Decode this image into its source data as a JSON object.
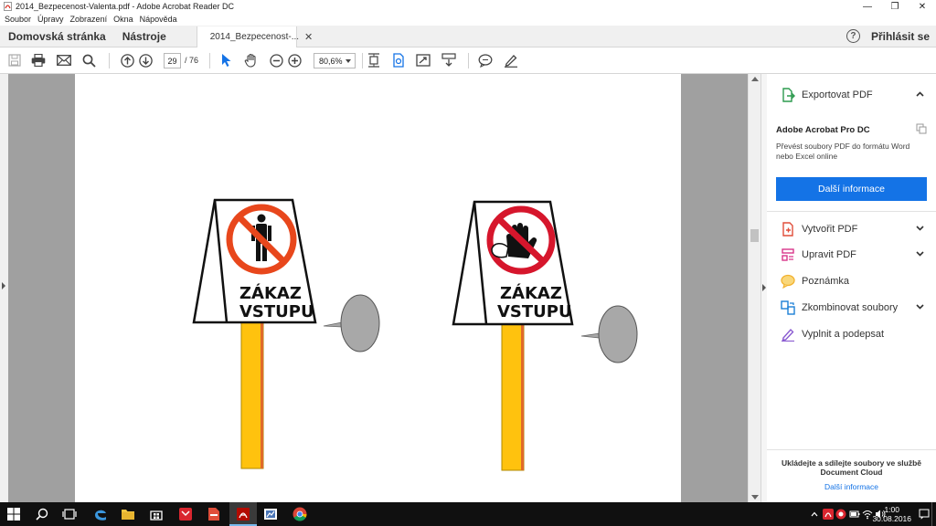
{
  "window": {
    "title": "2014_Bezpecenost-Valenta.pdf - Adobe Acrobat Reader DC",
    "controls": {
      "minimize": "—",
      "restore": "❐",
      "close": "✕"
    }
  },
  "menu": [
    "Soubor",
    "Úpravy",
    "Zobrazení",
    "Okna",
    "Nápověda"
  ],
  "tabs": {
    "home": "Domovská stránka",
    "tools": "Nástroje",
    "document": "2014_Bezpecenost-...",
    "close": "✕",
    "help": "?",
    "signin": "Přihlásit se"
  },
  "toolbar": {
    "page_current": "29",
    "page_total": "/ 76",
    "zoom": "80,6%"
  },
  "page_content": {
    "signs": [
      {
        "line1": "ZÁKAZ",
        "line2": "VSTUPU"
      },
      {
        "line1": "ZÁKAZ",
        "line2": "VSTUPU"
      }
    ]
  },
  "right_panel": {
    "export": {
      "label": "Exportovat PDF",
      "color": "#2d9b4f"
    },
    "promo": {
      "title": "Adobe Acrobat Pro DC",
      "text": "Převést soubory PDF do formátu Word nebo Excel online",
      "button": "Další informace",
      "button_color": "#1473e6"
    },
    "tools": [
      {
        "label": "Vytvořit PDF",
        "icon": "create-pdf-icon",
        "color": "#e04e3a",
        "expandable": true
      },
      {
        "label": "Upravit PDF",
        "icon": "edit-pdf-icon",
        "color": "#d9358a",
        "expandable": true
      },
      {
        "label": "Poznámka",
        "icon": "comment-icon",
        "color": "#f2b12e",
        "expandable": false
      },
      {
        "label": "Zkombinovat soubory",
        "icon": "combine-files-icon",
        "color": "#1c7fd6",
        "expandable": true
      },
      {
        "label": "Vyplnit a podepsat",
        "icon": "fill-sign-icon",
        "color": "#8a5bd1",
        "expandable": false
      }
    ],
    "cloud": {
      "text": "Ukládejte a sdílejte soubory ve službě Document Cloud",
      "link": "Další informace"
    }
  },
  "taskbar": {
    "time": "1:00",
    "date": "30.08.2016"
  }
}
